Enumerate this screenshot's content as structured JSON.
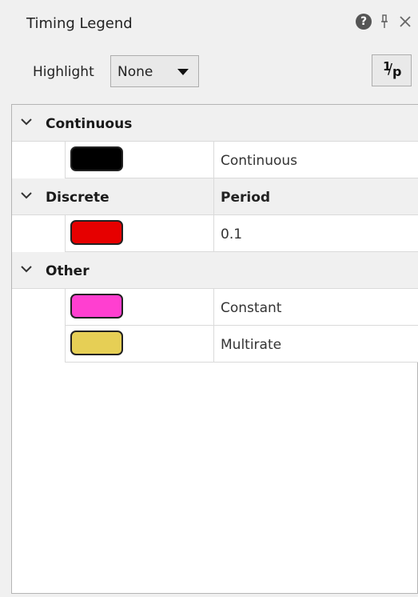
{
  "window": {
    "title": "Timing Legend",
    "icons": [
      "help-icon",
      "pin-icon",
      "close-icon"
    ]
  },
  "toolbar": {
    "highlight_label": "Highlight",
    "highlight_value": "None",
    "period_button_label": "1/p"
  },
  "groups": [
    {
      "name": "Continuous",
      "column_header": "",
      "items": [
        {
          "color": "#000000",
          "text": "Continuous"
        }
      ]
    },
    {
      "name": "Discrete",
      "column_header": "Period",
      "items": [
        {
          "color": "#e60000",
          "text": "0.1"
        }
      ]
    },
    {
      "name": "Other",
      "column_header": "",
      "items": [
        {
          "color": "#ff3fd0",
          "text": "Constant"
        },
        {
          "color": "#e6cf55",
          "text": "Multirate"
        }
      ]
    }
  ]
}
